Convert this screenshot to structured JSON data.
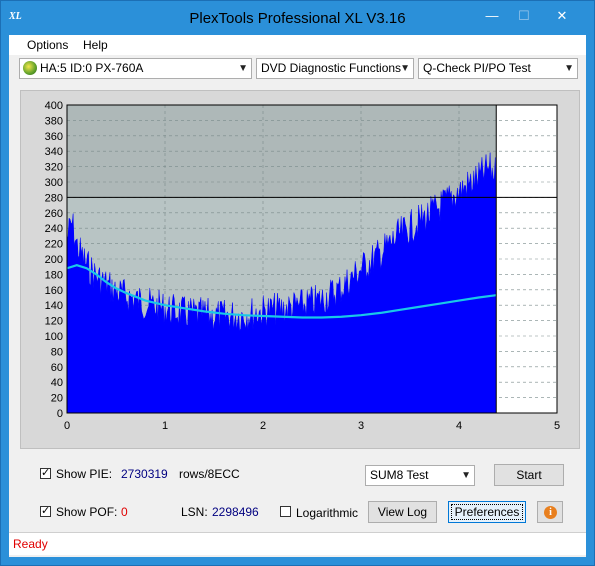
{
  "window": {
    "app_icon": "XL",
    "title": "PlexTools Professional XL V3.16",
    "minimize_glyph": "—",
    "maximize_glyph": "☐",
    "close_glyph": "✕"
  },
  "menu": {
    "items": [
      {
        "label": "Options"
      },
      {
        "label": "Help"
      }
    ]
  },
  "toolbar": {
    "drive_select": "HA:5 ID:0  PX-760A",
    "function_select": "DVD Diagnostic Functions",
    "test_select": "Q-Check PI/PO Test",
    "drive_icon": "cd-drive-icon"
  },
  "chart_data": {
    "type": "area",
    "title": "",
    "xlabel": "",
    "ylabel": "",
    "xlim": [
      0,
      5
    ],
    "ylim": [
      0,
      400
    ],
    "x_ticks": [
      "0",
      "1",
      "2",
      "3",
      "4",
      "5"
    ],
    "y_ticks": [
      "0",
      "20",
      "40",
      "60",
      "80",
      "100",
      "120",
      "140",
      "160",
      "180",
      "200",
      "220",
      "240",
      "260",
      "280",
      "300",
      "320",
      "340",
      "360",
      "380",
      "400"
    ],
    "threshold_line": 280,
    "data_end_x": 4.38,
    "grid": "dashed",
    "colors": {
      "pie": "#0000ff",
      "average": "#19c8e8",
      "plot_bg": "#b8c4c4",
      "plot_bg_empty": "#ffffff"
    },
    "series": [
      {
        "kind": "pie_envelope",
        "x": [
          0,
          0.05,
          0.1,
          0.2,
          0.3,
          0.4,
          0.5,
          0.6,
          0.8,
          1.0,
          1.2,
          1.4,
          1.6,
          1.8,
          2.0,
          2.2,
          2.4,
          2.6,
          2.8,
          3.0,
          3.2,
          3.4,
          3.6,
          3.8,
          4.0,
          4.2,
          4.3,
          4.38
        ],
        "values": [
          250,
          270,
          240,
          215,
          200,
          190,
          180,
          175,
          165,
          158,
          152,
          150,
          148,
          150,
          155,
          158,
          162,
          170,
          185,
          210,
          230,
          255,
          272,
          290,
          310,
          328,
          340,
          335
        ]
      },
      {
        "kind": "average",
        "x": [
          0,
          0.1,
          0.2,
          0.3,
          0.4,
          0.5,
          0.6,
          0.8,
          1.0,
          1.2,
          1.4,
          1.6,
          1.8,
          2.0,
          2.2,
          2.4,
          2.6,
          2.8,
          3.0,
          3.2,
          3.4,
          3.6,
          3.8,
          4.0,
          4.2,
          4.38
        ],
        "values": [
          188,
          192,
          188,
          180,
          170,
          162,
          156,
          146,
          140,
          136,
          132,
          129,
          127,
          126,
          125,
          124,
          124,
          125,
          127,
          130,
          134,
          138,
          142,
          146,
          150,
          153
        ]
      }
    ]
  },
  "controls": {
    "show_pie_label": "Show PIE:",
    "pie_value": "2730319",
    "pie_unit": "rows/8ECC",
    "show_poe_label": "Show POF:",
    "poe_value": "0",
    "lsn_label": "LSN:",
    "lsn_value": "2298496",
    "logarithmic_label": "Logarithmic",
    "sum_select": "SUM8 Test",
    "start_button": "Start",
    "view_log_button": "View Log",
    "preferences_button": "Preferences",
    "info_glyph": "i"
  },
  "status": {
    "text": "Ready"
  }
}
